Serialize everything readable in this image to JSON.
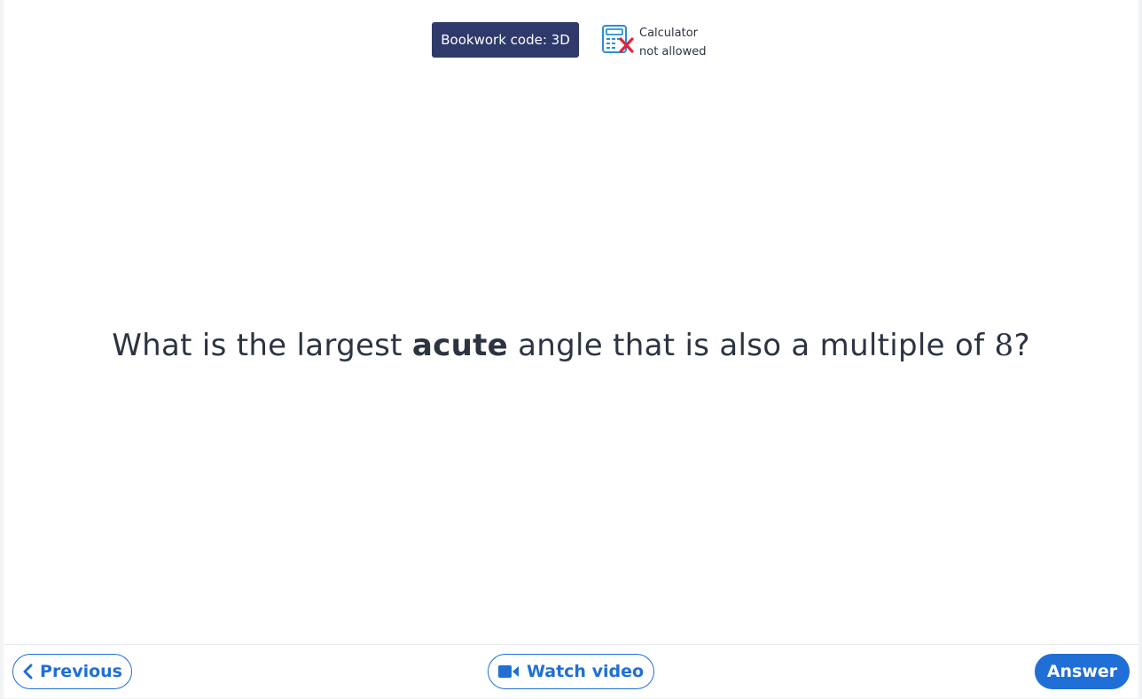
{
  "header": {
    "bookwork_label": "Bookwork code: 3D",
    "calculator_line1": "Calculator",
    "calculator_line2": "not allowed",
    "calculator_icon": "calculator-not-allowed-icon"
  },
  "question": {
    "part1": "What is the largest ",
    "emphasis": "acute",
    "part2": " angle that is also a multiple of ",
    "number": "8",
    "part3": "?"
  },
  "footer": {
    "previous_label": "Previous",
    "previous_icon": "chevron-left-icon",
    "video_label": "Watch video",
    "video_icon": "video-camera-icon",
    "answer_label": "Answer"
  },
  "colors": {
    "primary": "#1f6fd6",
    "bookwork_bg": "#2f3a6b",
    "text": "#2c3442",
    "cross": "#e0243a"
  }
}
